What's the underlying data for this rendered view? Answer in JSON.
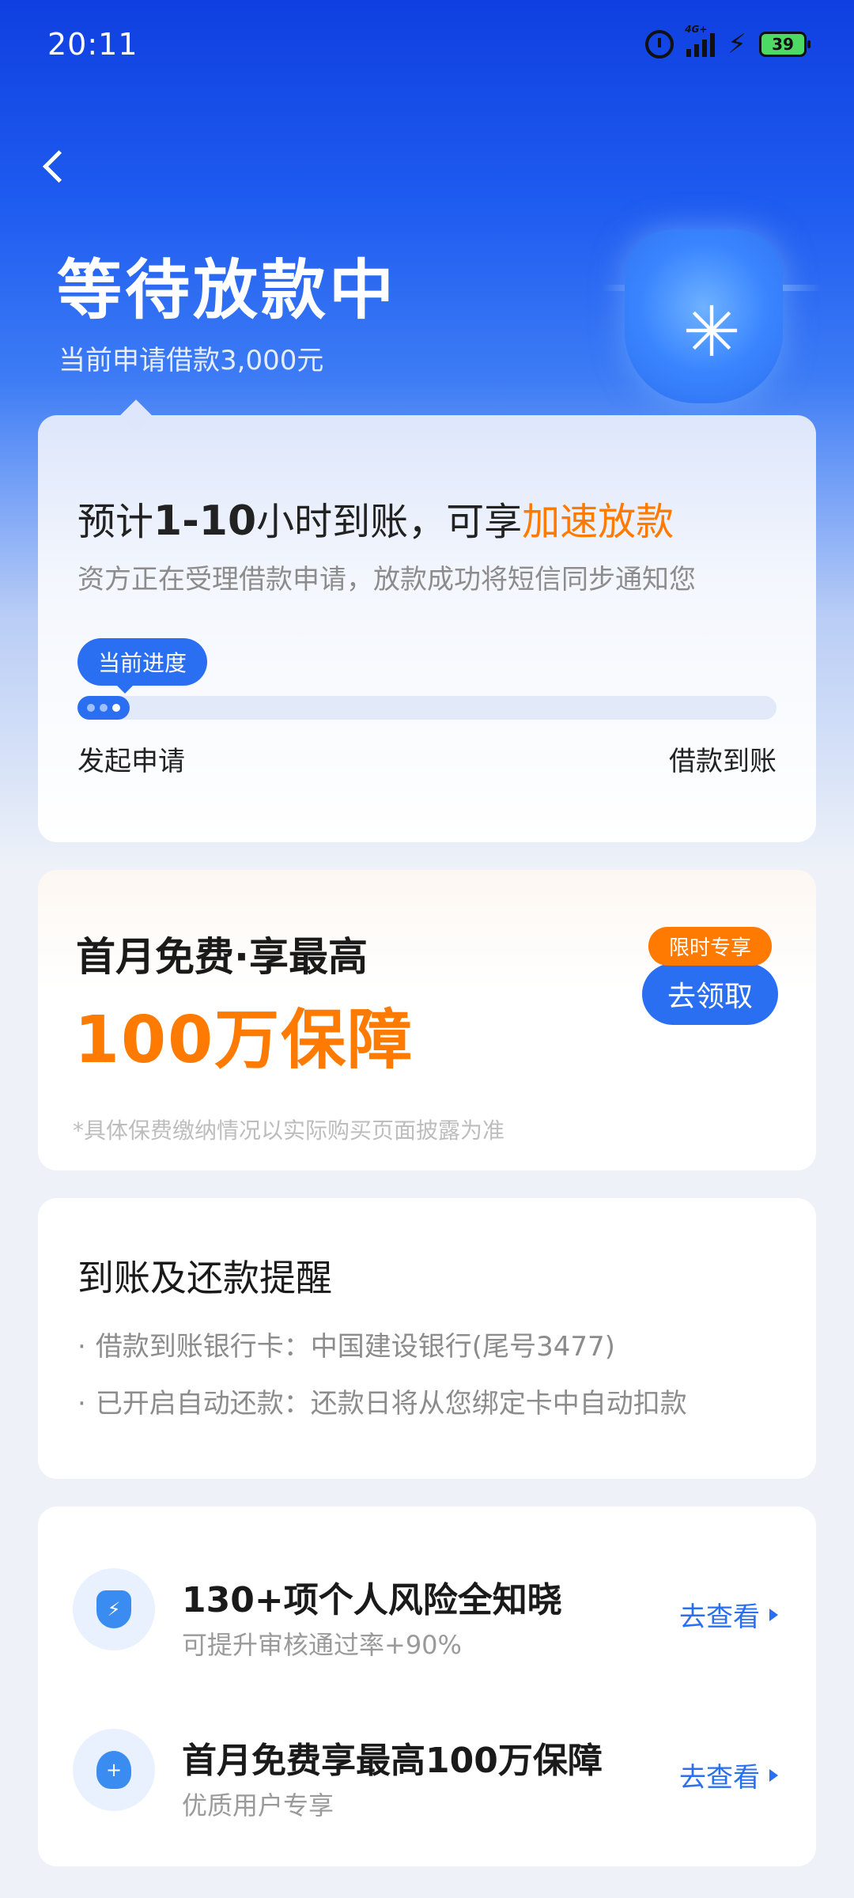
{
  "status": {
    "time": "20:11",
    "network": "4G+",
    "battery": "39"
  },
  "header": {
    "title": "等待放款中",
    "subtitle": "当前申请借款3,000元"
  },
  "progress_card": {
    "eta_prefix": "预计",
    "eta_hours": "1-10",
    "eta_mid": "小时到账，可享",
    "eta_accent": "加速放款",
    "description": "资方正在受理借款申请，放款成功将短信同步通知您",
    "tag": "当前进度",
    "progress_fraction": 0.075,
    "step_start": "发起申请",
    "step_end": "借款到账"
  },
  "promo_card": {
    "title": "首月免费·享最高",
    "big_text": "100万保障",
    "note": "*具体保费缴纳情况以实际购买页面披露为准",
    "badge": "限时专享",
    "button": "去领取"
  },
  "remind_card": {
    "title": "到账及还款提醒",
    "items": [
      "借款到账银行卡：中国建设银行(尾号3477)",
      "已开启自动还款：还款日将从您绑定卡中自动扣款"
    ]
  },
  "services": [
    {
      "icon": "shield-bolt-icon",
      "title": "130+项个人风险全知晓",
      "sub": "可提升审核通过率+90%",
      "link": "去查看"
    },
    {
      "icon": "heart-plus-icon",
      "title": "首月免费享最高100万保障",
      "sub": "优质用户专享",
      "link": "去查看"
    }
  ],
  "colors": {
    "primary": "#2a6ff2",
    "accent": "#ff7a00",
    "header_bg": "#1f5cf0"
  }
}
